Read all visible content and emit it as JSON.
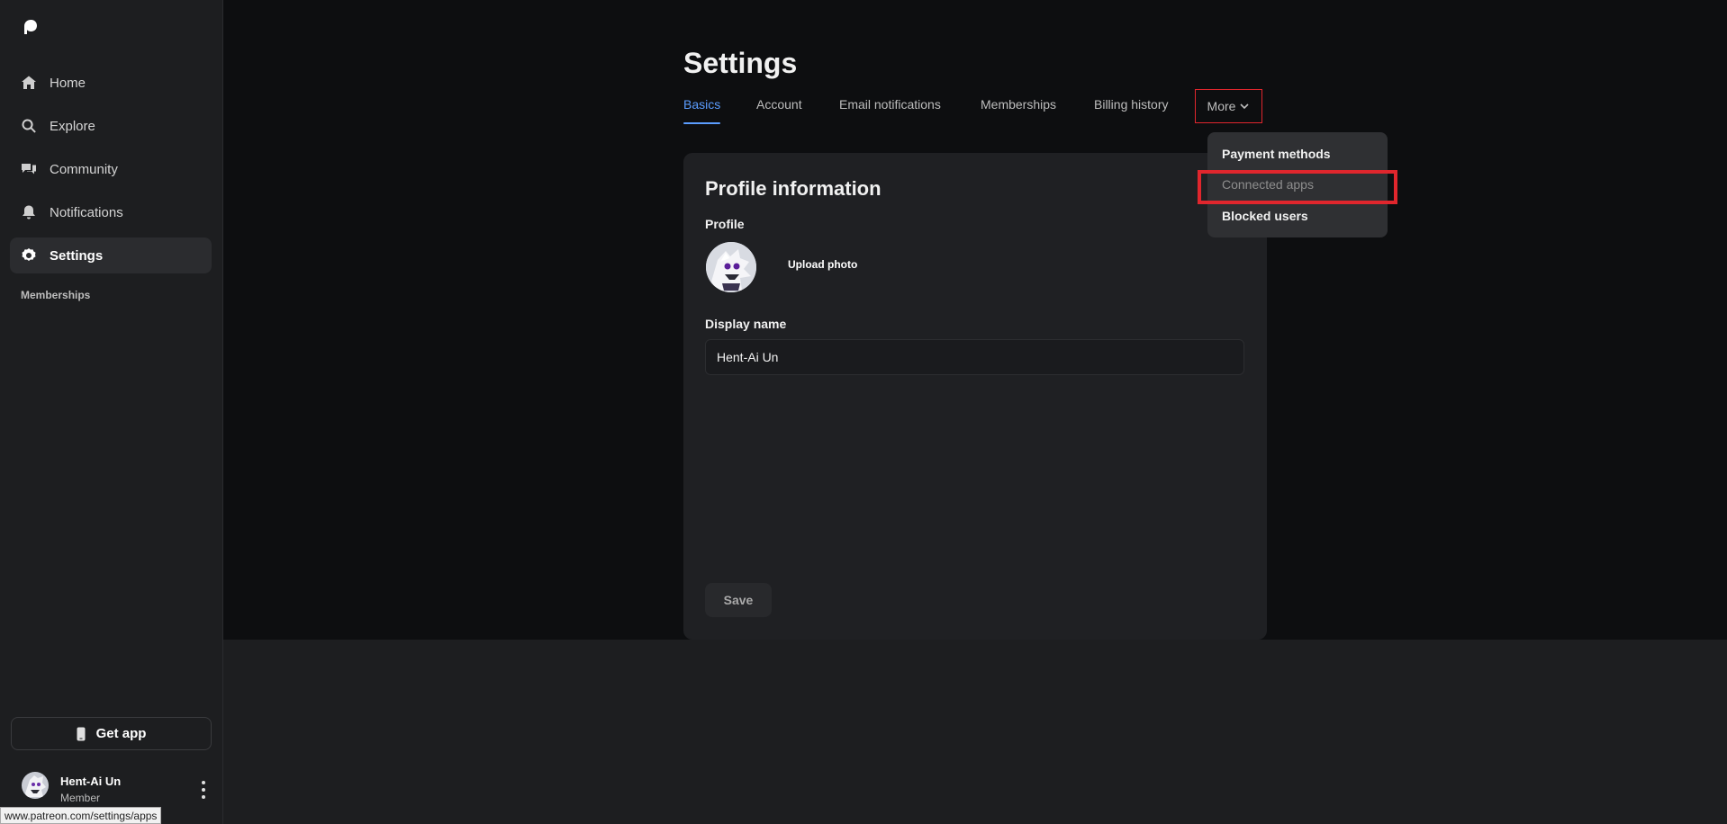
{
  "sidebar": {
    "logo": "patreon-logo",
    "items": [
      {
        "label": "Home",
        "icon": "home-icon"
      },
      {
        "label": "Explore",
        "icon": "search-icon"
      },
      {
        "label": "Community",
        "icon": "chat-bubbles-icon"
      },
      {
        "label": "Notifications",
        "icon": "bell-icon"
      },
      {
        "label": "Settings",
        "icon": "gear-icon",
        "active": true
      }
    ],
    "section_label": "Memberships",
    "get_app_label": "Get app",
    "user": {
      "name": "Hent-Ai Un",
      "role": "Member"
    }
  },
  "page": {
    "title": "Settings",
    "tabs": [
      "Basics",
      "Account",
      "Email notifications",
      "Memberships",
      "Billing history"
    ],
    "more_label": "More",
    "active_tab": "Basics"
  },
  "dropdown": {
    "items": [
      "Payment methods",
      "Connected apps",
      "Blocked users"
    ],
    "hovered": "Connected apps"
  },
  "profile_card": {
    "title": "Profile information",
    "profile_label": "Profile",
    "upload_label": "Upload photo",
    "display_name_label": "Display name",
    "display_name_value": "Hent-Ai Un",
    "save_label": "Save"
  },
  "status_bar": {
    "url": "www.patreon.com/settings/apps"
  },
  "colors": {
    "accent": "#5b9dff",
    "highlight": "#e0262d",
    "background": "#0d0e10",
    "sidebar": "#1d1e20"
  }
}
